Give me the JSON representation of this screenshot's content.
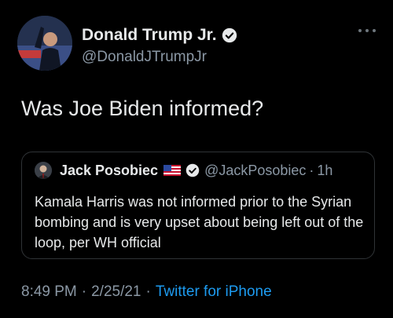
{
  "author": {
    "display_name": "Donald Trump Jr.",
    "handle": "@DonaldJTrumpJr",
    "verified_icon": "verified-badge-icon"
  },
  "tweet": {
    "text": "Was Joe Biden informed?"
  },
  "quoted_tweet": {
    "display_name": "Jack Posobiec",
    "flag_icon": "us-flag-icon",
    "handle": "@JackPosobiec",
    "separator": "·",
    "time": "1h",
    "text": "Kamala Harris was not informed prior to the Syrian bombing and is very upset about being left out of the loop, per WH official"
  },
  "meta": {
    "time": "8:49 PM",
    "separator": "·",
    "date": "2/25/21",
    "source": "Twitter for iPhone"
  },
  "colors": {
    "background": "#000000",
    "text": "#e7e9ea",
    "secondary": "#8b98a5",
    "link": "#1d9bf0",
    "border": "#2f3336"
  }
}
